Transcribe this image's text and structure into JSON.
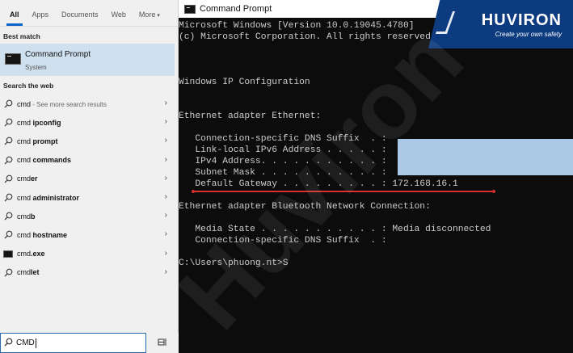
{
  "search": {
    "tabs": [
      {
        "label": "All",
        "active": true
      },
      {
        "label": "Apps"
      },
      {
        "label": "Documents"
      },
      {
        "label": "Web"
      },
      {
        "label": "More"
      }
    ],
    "best_match_label": "Best match",
    "best_match": {
      "title": "Command Prompt",
      "subtitle": "System"
    },
    "search_web_label": "Search the web",
    "results": [
      {
        "prefix": "cmd",
        "bold": "",
        "suffix": " - See more search results",
        "icon": "search-icon"
      },
      {
        "prefix": "cmd ",
        "bold": "ipconfig",
        "suffix": "",
        "icon": "search-icon"
      },
      {
        "prefix": "cmd ",
        "bold": "prompt",
        "suffix": "",
        "icon": "search-icon"
      },
      {
        "prefix": "cmd ",
        "bold": "commands",
        "suffix": "",
        "icon": "search-icon"
      },
      {
        "prefix": "cmd",
        "bold": "er",
        "suffix": "",
        "icon": "search-icon"
      },
      {
        "prefix": "cmd ",
        "bold": "administrator",
        "suffix": "",
        "icon": "search-icon"
      },
      {
        "prefix": "cmd",
        "bold": "b",
        "suffix": "",
        "icon": "search-icon"
      },
      {
        "prefix": "cmd ",
        "bold": "hostname",
        "suffix": "",
        "icon": "search-icon"
      },
      {
        "prefix": "cmd",
        "bold": ".exe",
        "suffix": "",
        "icon": "console-app-icon"
      },
      {
        "prefix": "cmd",
        "bold": "let",
        "suffix": "",
        "icon": "search-icon"
      }
    ],
    "query": "CMD"
  },
  "console": {
    "title": "Command Prompt",
    "lines": [
      "Microsoft Windows [Version 10.0.19045.4780]",
      "(c) Microsoft Corporation. All rights reserved.",
      "Windows IP Configuration",
      "Ethernet adapter Ethernet:",
      "   Connection-specific DNS Suffix  . :",
      "   Link-local IPv6 Address . . . . . :",
      "   IPv4 Address. . . . . . . . . . . :",
      "   Subnet Mask . . . . . . . . . . . :",
      "   Default Gateway . . . . . . . . . : 172.168.16.1",
      "Ethernet adapter Bluetooth Network Connection:",
      "   Media State . . . . . . . . . . . : Media disconnected",
      "   Connection-specific DNS Suffix  . :",
      "C:\\Users\\phuong.nt>S"
    ]
  },
  "brand": {
    "name": "HUVIRON",
    "tagline": "Create your own safety",
    "watermark": "Huviron"
  },
  "colors": {
    "accent": "#0a64c8",
    "highlight": "#cfe0ef",
    "console_bg": "#0c0c0c",
    "console_text": "#cccccc",
    "annotation": "#d9302c",
    "brand": "#0d3b80",
    "redaction": "#a9c9e6"
  }
}
